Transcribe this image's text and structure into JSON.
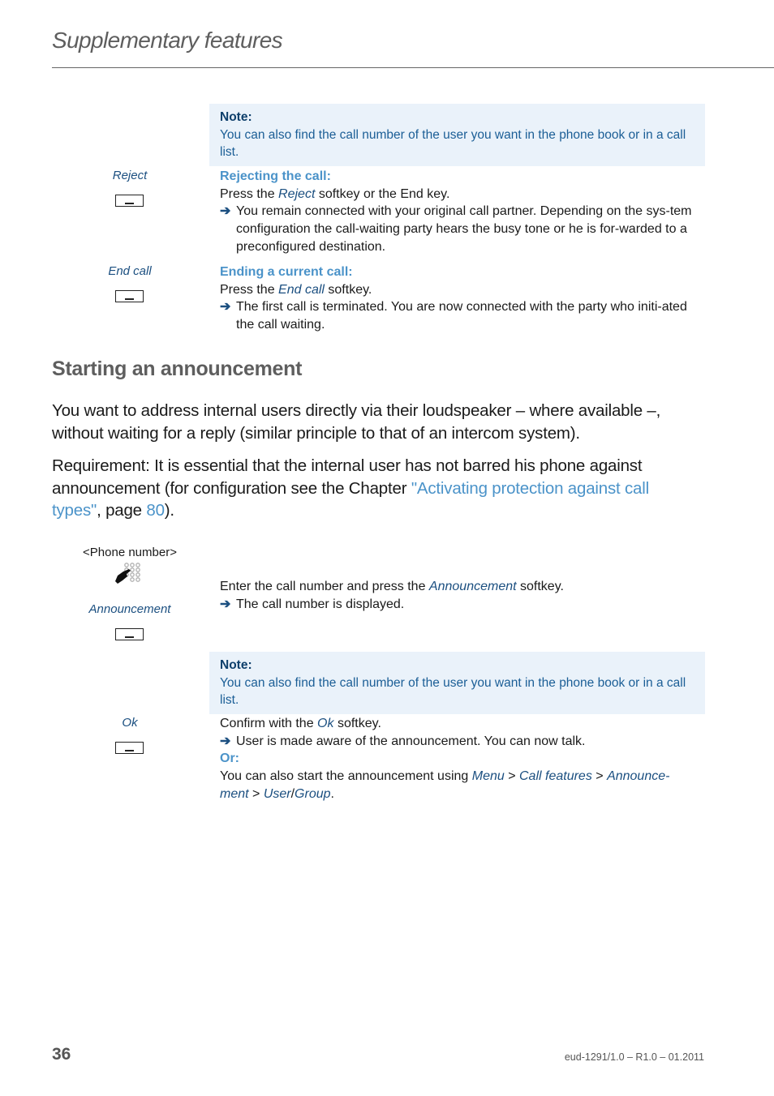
{
  "header": {
    "running_title": "Supplementary features"
  },
  "note_1": {
    "title": "Note:",
    "text": "You can also find the call number of the user you want in the phone book or in a call list."
  },
  "reject_step": {
    "softkey_label": "Reject",
    "heading": "Rejecting the call:",
    "instruction_prefix": "Press the ",
    "instruction_key": "Reject",
    "instruction_suffix": " softkey or the End key.",
    "result": "You remain connected with your original call partner. Depending on the sys-tem configuration the call-waiting party hears the busy tone or he is for-warded to a preconfigured destination."
  },
  "end_call_step": {
    "softkey_label": "End call",
    "heading": "Ending a current call:",
    "instruction_prefix": "Press the ",
    "instruction_key": "End call",
    "instruction_suffix": " softkey.",
    "result": "The first call is terminated. You are now connected with the party who initi-ated the call waiting."
  },
  "section": {
    "title": "Starting an announcement",
    "intro": "You want to address internal users directly via their loudspeaker – where available –, without waiting for a reply (similar principle to that of an intercom system).",
    "requirement_prefix": "Requirement: It is essential that the internal user has not barred his phone against announcement (for configuration see the Chapter ",
    "requirement_link": "\"Activating protection against call types\"",
    "requirement_mid": ", page ",
    "requirement_page": "80",
    "requirement_suffix": ")."
  },
  "announcement_step": {
    "input_label": "<Phone number>",
    "dial_icon": "keypad-dial-icon",
    "softkey_label": "Announcement",
    "instruction_prefix": "Enter the call number and press the ",
    "instruction_key": "Announcement",
    "instruction_suffix": " softkey.",
    "result": "The call number is displayed."
  },
  "note_2": {
    "title": "Note:",
    "text": "You can also find the call number of the user you want in the phone book or in a call list."
  },
  "ok_step": {
    "softkey_label": "Ok",
    "instruction_prefix": "Confirm with the ",
    "instruction_key": "Ok",
    "instruction_suffix": " softkey.",
    "result": "User is made aware of the announcement. You can now talk.",
    "or_label": "Or:",
    "alt_prefix": "You can also start the announcement using ",
    "alt_menu": "Menu",
    "alt_sep1": " > ",
    "alt_call_features": "Call features",
    "alt_sep2": " > ",
    "alt_announcement": "Announce-ment",
    "alt_sep3": " > ",
    "alt_user": "User",
    "alt_slash": "/",
    "alt_group": "Group",
    "alt_end": "."
  },
  "footer": {
    "page_number": "36",
    "doc_id": "eud-1291/1.0 – R1.0 – 01.2011"
  },
  "icons": {
    "result_arrow": "➔"
  }
}
